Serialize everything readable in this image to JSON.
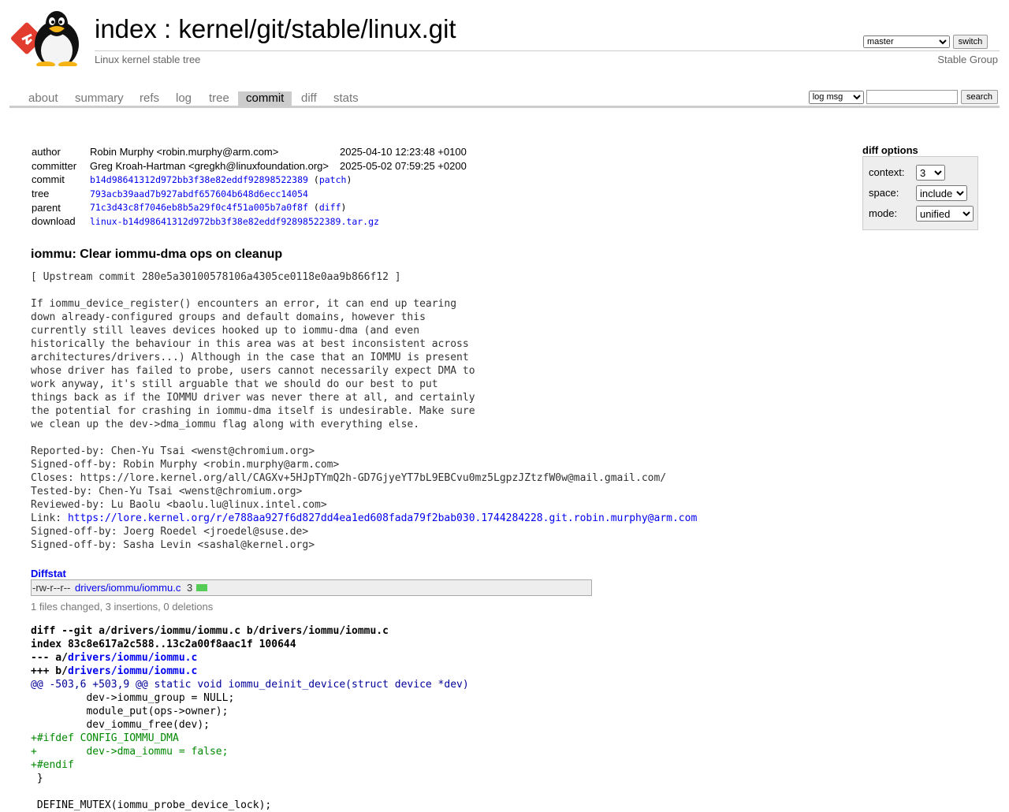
{
  "header": {
    "title_index": "index",
    "title_sep": " : ",
    "title_repo": "kernel/git/stable/linux.git",
    "subtitle": "Linux kernel stable tree",
    "owner": "Stable Group",
    "branch_selected": "master",
    "switch_label": "switch"
  },
  "tabs": [
    {
      "label": "about"
    },
    {
      "label": "summary"
    },
    {
      "label": "refs"
    },
    {
      "label": "log"
    },
    {
      "label": "tree"
    },
    {
      "label": "commit"
    },
    {
      "label": "diff"
    },
    {
      "label": "stats"
    }
  ],
  "search": {
    "type_selected": "log msg",
    "query": "",
    "button_label": "search"
  },
  "commit_info": {
    "author_label": "author",
    "author": "Robin Murphy <robin.murphy@arm.com>",
    "author_date": "2025-04-10 12:23:48 +0100",
    "committer_label": "committer",
    "committer": "Greg Kroah-Hartman <gregkh@linuxfoundation.org>",
    "committer_date": "2025-05-02 07:59:25 +0200",
    "commit_label": "commit",
    "commit_sha": "b14d98641312d972bb3f38e82eddf92898522389",
    "patch_link": "patch",
    "tree_label": "tree",
    "tree_sha": "793acb39aad7b927abdf657604b648d6ecc14054",
    "parent_label": "parent",
    "parent_sha": "71c3d43c8f7046eb8b5a29f0c4f51a005b7a0f8f",
    "diff_link": "diff",
    "download_label": "download",
    "download_file": "linux-b14d98641312d972bb3f38e82eddf92898522389.tar.gz"
  },
  "diff_options": {
    "title": "diff options",
    "context_label": "context:",
    "context_value": "3",
    "space_label": "space:",
    "space_value": "include",
    "mode_label": "mode:",
    "mode_value": "unified"
  },
  "message": {
    "subject": "iommu: Clear iommu-dma ops on cleanup",
    "body": "[ Upstream commit 280e5a30100578106a4305ce0118e0aa9b866f12 ]\n\nIf iommu_device_register() encounters an error, it can end up tearing\ndown already-configured groups and default domains, however this\ncurrently still leaves devices hooked up to iommu-dma (and even\nhistorically the behaviour in this area was at best inconsistent across\narchitectures/drivers...) Although in the case that an IOMMU is present\nwhose driver has failed to probe, users cannot necessarily expect DMA to\nwork anyway, it's still arguable that we should do our best to put\nthings back as if the IOMMU driver was never there at all, and certainly\nthe potential for crashing in iommu-dma itself is undesirable. Make sure\nwe clean up the dev->dma_iommu flag along with everything else.\n\nReported-by: Chen-Yu Tsai <wenst@chromium.org>\nSigned-off-by: Robin Murphy <robin.murphy@arm.com>\nCloses: https://lore.kernel.org/all/CAGXv+5HJpTYmQ2h-GD7GjyeYT7bL9EBCvu0mz5LgpzJZtzfW0w@mail.gmail.com/\nTested-by: Chen-Yu Tsai <wenst@chromium.org>\nReviewed-by: Lu Baolu <baolu.lu@linux.intel.com>",
    "link_prefix": "Link: ",
    "link_url": "https://lore.kernel.org/r/e788aa927f6d827dd4ea1ed608fada79f2bab030.1744284228.git.robin.murphy@arm.com",
    "tail": "Signed-off-by: Joerg Roedel <jroedel@suse.de>\nSigned-off-by: Sasha Levin <sashal@kernel.org>"
  },
  "diffstat": {
    "header": "Diffstat",
    "mode": "-rw-r--r--",
    "file": "drivers/iommu/iommu.c",
    "count": "3",
    "summary": "1 files changed, 3 insertions, 0 deletions"
  },
  "diff": {
    "git_line": "diff --git a/drivers/iommu/iommu.c b/drivers/iommu/iommu.c",
    "index_line": "index 83c8e617a2c588..13c2a00f8aac1f 100644",
    "minus_prefix": "--- a/",
    "minus_file": "drivers/iommu/iommu.c",
    "plus_prefix": "+++ b/",
    "plus_file": "drivers/iommu/iommu.c",
    "hunk": "@@ -503,6 +503,9 @@ static void iommu_deinit_device(struct device *dev)",
    "lines": [
      {
        "type": "ctx",
        "text": " \tdev->iommu_group = NULL;"
      },
      {
        "type": "ctx",
        "text": " \tmodule_put(ops->owner);"
      },
      {
        "type": "ctx",
        "text": " \tdev_iommu_free(dev);"
      },
      {
        "type": "add",
        "text": "+#ifdef CONFIG_IOMMU_DMA"
      },
      {
        "type": "add",
        "text": "+\tdev->dma_iommu = false;"
      },
      {
        "type": "add",
        "text": "+#endif"
      },
      {
        "type": "ctx",
        "text": " }"
      },
      {
        "type": "ctx",
        "text": " "
      },
      {
        "type": "ctx",
        "text": " DEFINE_MUTEX(iommu_probe_device_lock);"
      }
    ]
  }
}
